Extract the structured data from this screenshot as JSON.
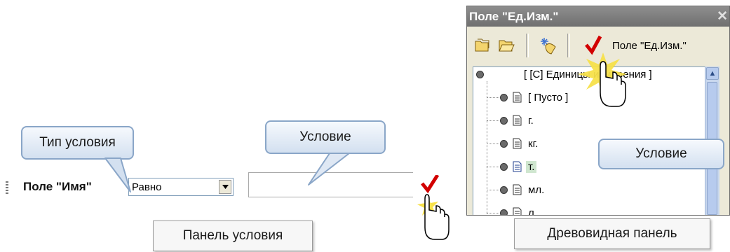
{
  "condition_panel": {
    "field_label": "Поле \"Имя\"",
    "condition_type_value": "Равно",
    "condition_value": ""
  },
  "callouts": {
    "condition_type": "Тип условия",
    "condition_top": "Условие",
    "condition_tree": "Условие"
  },
  "captions": {
    "condition_panel": "Панель условия",
    "tree_panel": "Древовидная панель"
  },
  "tree_panel": {
    "title": "Поле \"Ед.Изм.\"",
    "toolbar_label": "Поле \"Ед.Изм.\"",
    "root": "[ [С] Единицы измерения ]",
    "items": [
      "[ Пусто ]",
      "г.",
      "кг.",
      "т.",
      "мл.",
      "л."
    ],
    "selected": "т."
  },
  "colors": {
    "callout_border": "#8aa6c8",
    "callout_fill": "#d3e0f0",
    "selection": "#cfe6cf",
    "titlebar": "#7f7f7f"
  }
}
